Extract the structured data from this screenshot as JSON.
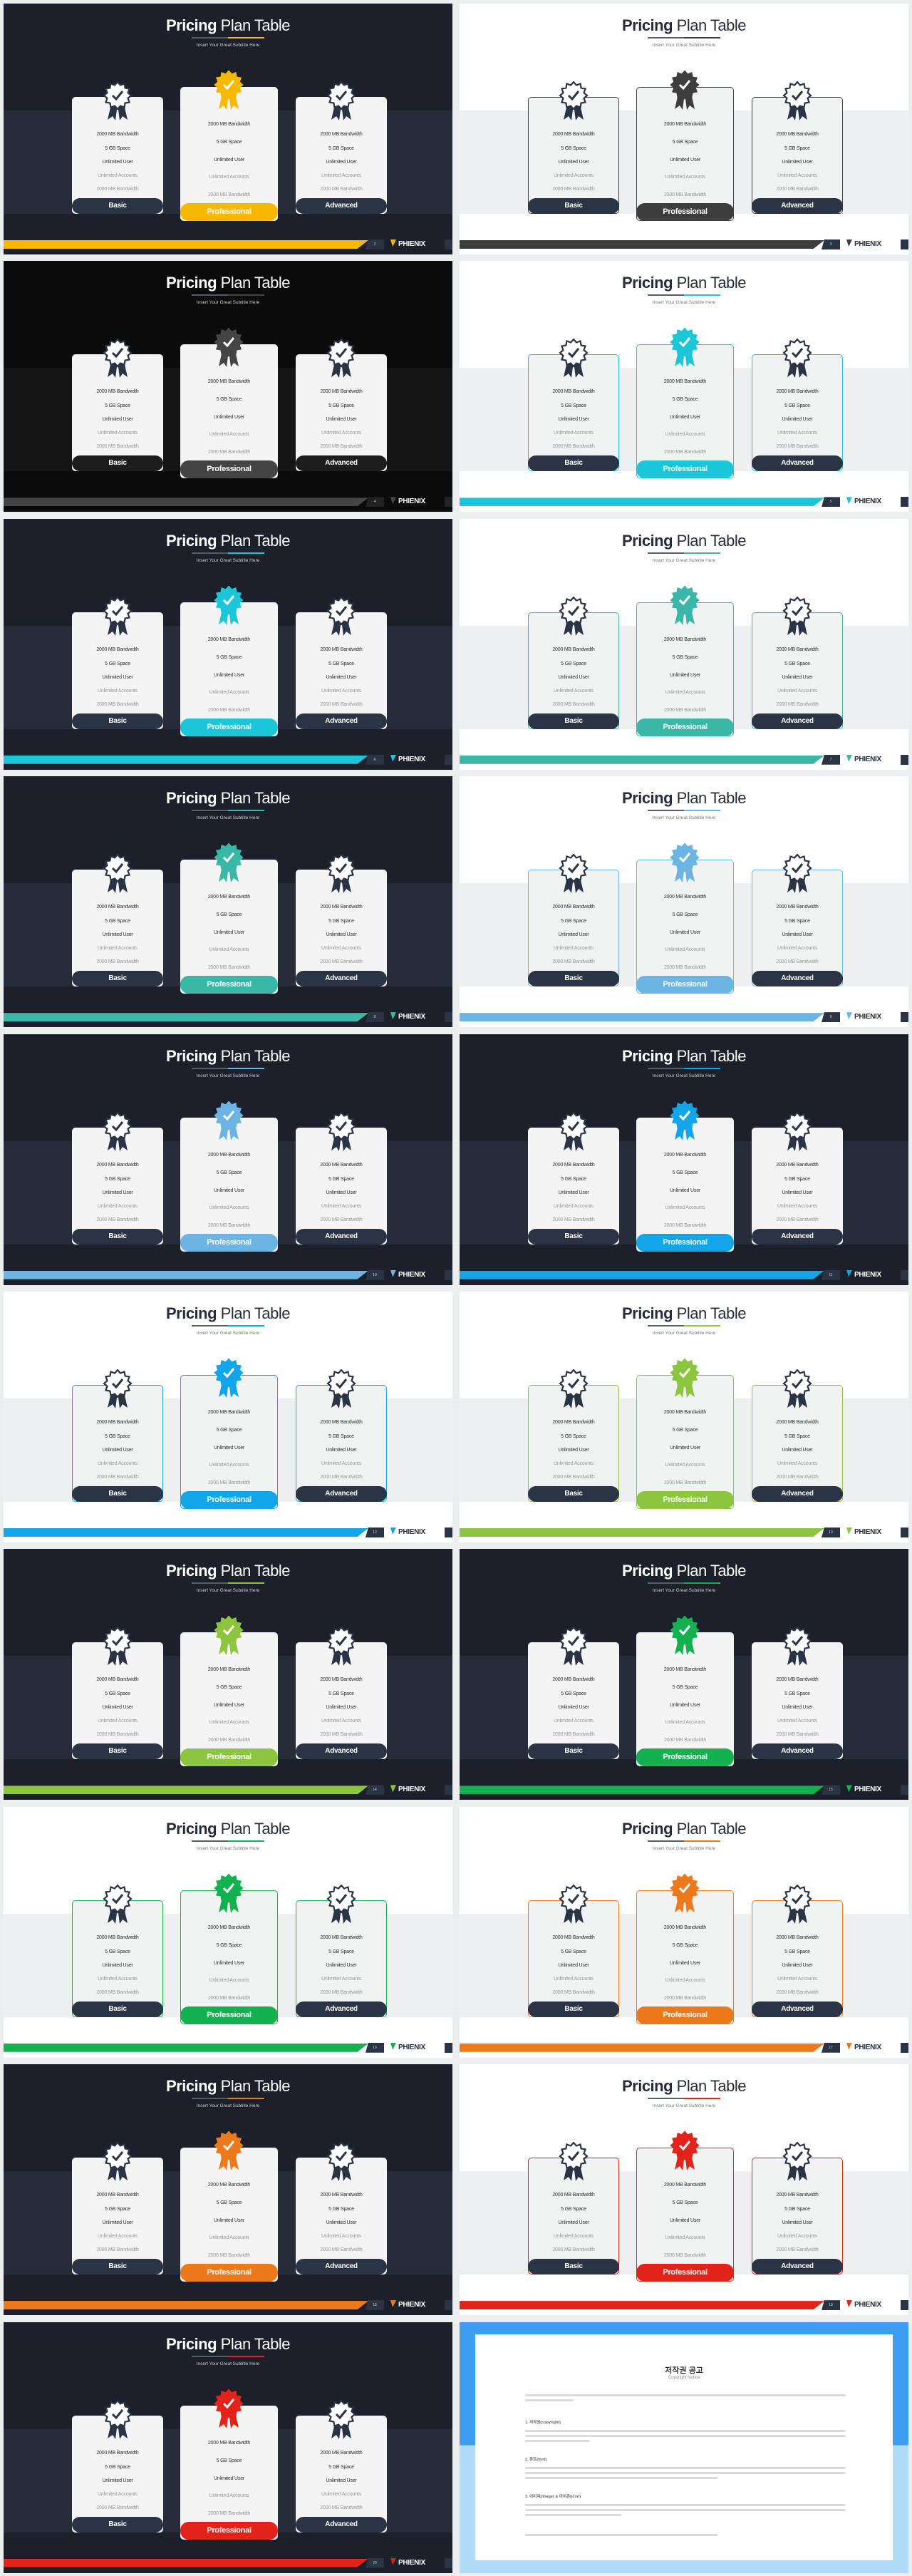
{
  "deck": {
    "title_bold": "Pricing",
    "title_regular": "Plan Table",
    "subtitle": "Insert Your Great Subtitle Here",
    "brand": "PHIENIX",
    "plans": [
      {
        "name": "Basic",
        "features": [
          "2000 MB Bandwidth",
          "5 GB Space",
          "Unlimited User",
          "Unlimited Accounts",
          "2000 MB Bandwidth"
        ]
      },
      {
        "name": "Professional",
        "features": [
          "2000 MB Bandwidth",
          "5 GB Space",
          "Unlimited User",
          "Unlimited Accounts",
          "2000 MB Bandwidth"
        ]
      },
      {
        "name": "Advanced",
        "features": [
          "2000 MB Bandwidth",
          "5 GB Space",
          "Unlimited User",
          "Unlimited Accounts",
          "2000 MB Bandwidth"
        ]
      }
    ],
    "badge_icon": "award-ribbon-check-icon",
    "colors": {
      "navy": "#2b3444",
      "dark_bg": "#1b202a",
      "light_band": "#eeeff0"
    }
  },
  "slides": [
    {
      "theme": "dark",
      "accent": "#f7b900",
      "page": "2"
    },
    {
      "theme": "light",
      "accent": "#3d3d3d",
      "page": "3"
    },
    {
      "theme": "black",
      "accent": "#444444",
      "page": "4"
    },
    {
      "theme": "light",
      "accent": "#1cc6d9",
      "page": "5"
    },
    {
      "theme": "dark",
      "accent": "#1cc6d9",
      "page": "6"
    },
    {
      "theme": "light",
      "accent": "#3ab7a6",
      "page": "7"
    },
    {
      "theme": "dark",
      "accent": "#3ab7a6",
      "page": "8"
    },
    {
      "theme": "light",
      "accent": "#6cb4e2",
      "page": "9"
    },
    {
      "theme": "dark",
      "accent": "#6cb4e2",
      "page": "10"
    },
    {
      "theme": "dark",
      "accent": "#12a5ea",
      "page": "11"
    },
    {
      "theme": "light",
      "accent": "#12a5ea",
      "page": "12"
    },
    {
      "theme": "light",
      "accent": "#8cc63e",
      "page": "13"
    },
    {
      "theme": "dark",
      "accent": "#8cc63e",
      "page": "14"
    },
    {
      "theme": "dark",
      "accent": "#13b14f",
      "page": "15"
    },
    {
      "theme": "light",
      "accent": "#13b14f",
      "page": "16"
    },
    {
      "theme": "light",
      "accent": "#ec7a1c",
      "page": "17"
    },
    {
      "theme": "dark",
      "accent": "#ec7a1c",
      "page": "18"
    },
    {
      "theme": "light",
      "accent": "#e2231a",
      "page": "19"
    },
    {
      "theme": "dark",
      "accent": "#e2231a",
      "page": "20"
    }
  ],
  "copyright": {
    "title": "저작권 공고",
    "subtitle": "Copyright Notice",
    "sections": [
      "1. 저작권(copyright)",
      "2. 폰트(font)",
      "3. 이미지(image) & 아이콘(icon)"
    ],
    "colors": {
      "top": "#3d9ef0",
      "bottom": "#b0dcf7"
    }
  }
}
